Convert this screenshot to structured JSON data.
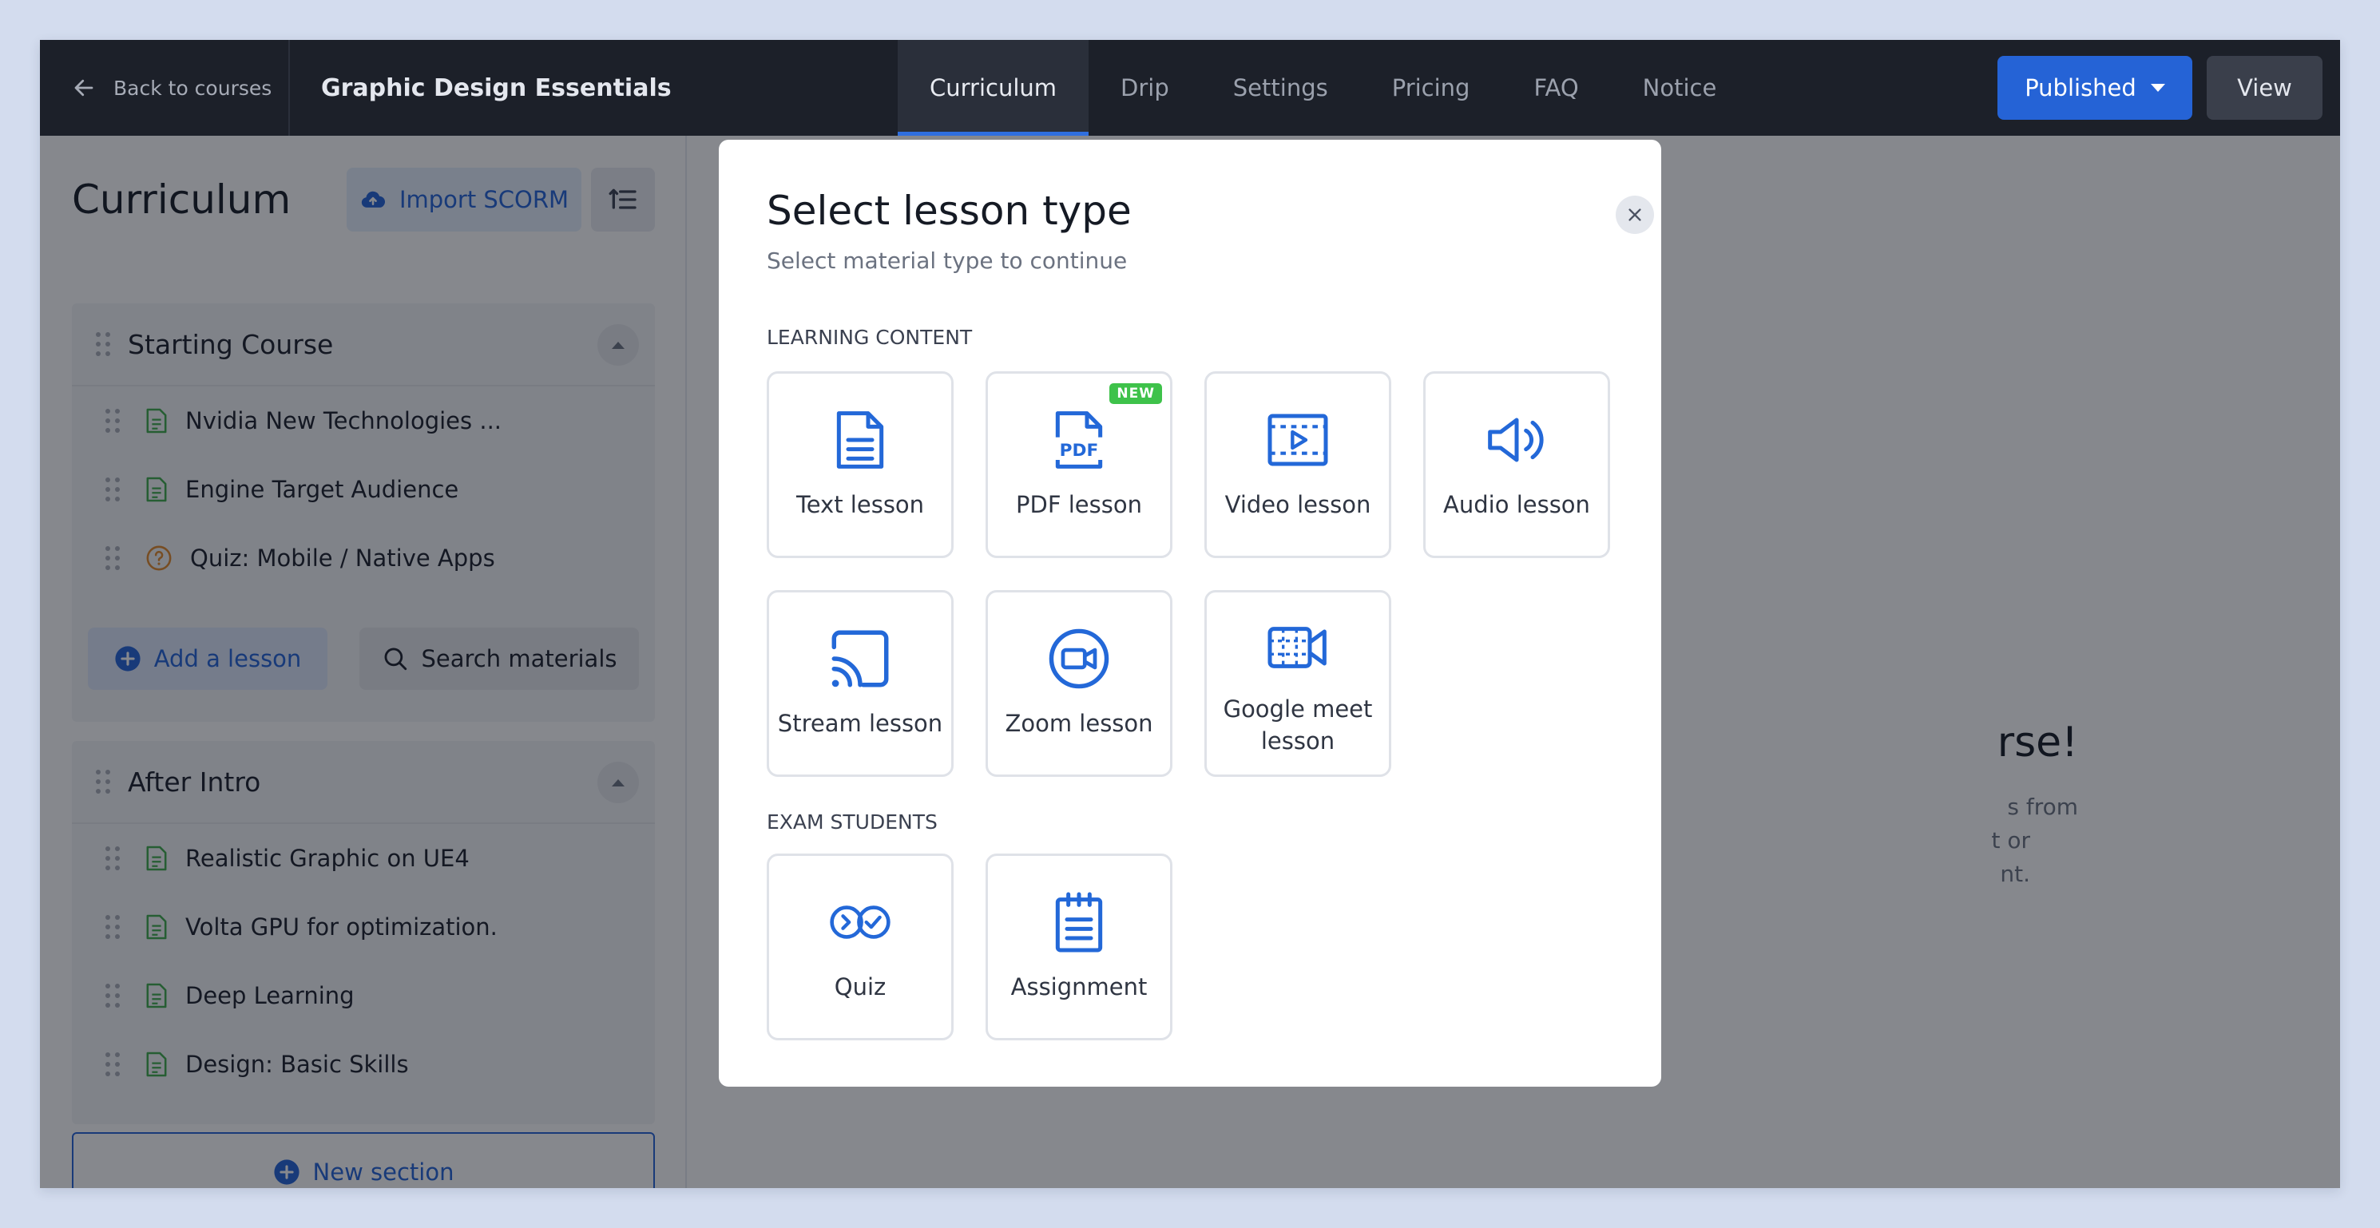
{
  "topbar": {
    "back_label": "Back to courses",
    "course_title": "Graphic Design Essentials",
    "tabs": [
      {
        "label": "Curriculum",
        "active": true
      },
      {
        "label": "Drip",
        "active": false
      },
      {
        "label": "Settings",
        "active": false
      },
      {
        "label": "Pricing",
        "active": false
      },
      {
        "label": "FAQ",
        "active": false
      },
      {
        "label": "Notice",
        "active": false
      }
    ],
    "status_label": "Published",
    "view_label": "View"
  },
  "curriculum": {
    "title": "Curriculum",
    "import_label": "Import SCORM",
    "sections": [
      {
        "name": "Starting Course",
        "lessons": [
          {
            "title": "Nvidia New Technologies ...",
            "type": "text",
            "icon": "document-icon"
          },
          {
            "title": "Engine Target Audience",
            "type": "text",
            "icon": "document-icon"
          },
          {
            "title": "Quiz: Mobile / Native Apps",
            "type": "quiz",
            "icon": "question-icon"
          }
        ],
        "add_lesson_label": "Add a lesson",
        "search_label": "Search materials"
      },
      {
        "name": "After Intro",
        "lessons": [
          {
            "title": "Realistic Graphic on UE4",
            "type": "text",
            "icon": "document-icon"
          },
          {
            "title": "Volta GPU for optimization.",
            "type": "text",
            "icon": "document-icon"
          },
          {
            "title": "Deep Learning",
            "type": "text",
            "icon": "document-icon"
          },
          {
            "title": "Design: Basic Skills",
            "type": "text",
            "icon": "document-icon"
          }
        ]
      }
    ],
    "new_section_label": "New section"
  },
  "background_content": {
    "heading": "rse!",
    "text_lines": [
      "s from",
      "t or",
      "nt."
    ]
  },
  "modal": {
    "title": "Select lesson type",
    "subtitle": "Select material type to continue",
    "group_learning": "Learning content",
    "group_exam": "Exam students",
    "badge_new": "NEW",
    "types": {
      "text": "Text lesson",
      "pdf": "PDF lesson",
      "video": "Video lesson",
      "audio": "Audio lesson",
      "stream": "Stream lesson",
      "zoom": "Zoom lesson",
      "gmeet": "Google meet lesson",
      "quiz": "Quiz",
      "assignment": "Assignment"
    }
  },
  "colors": {
    "accent": "#2563d6",
    "topbar_bg": "#1c2029",
    "doc_icon": "#3eaa4a",
    "quiz_icon": "#e0892a",
    "new_badge": "#3ec24a",
    "page_bg": "#d3dcee"
  }
}
